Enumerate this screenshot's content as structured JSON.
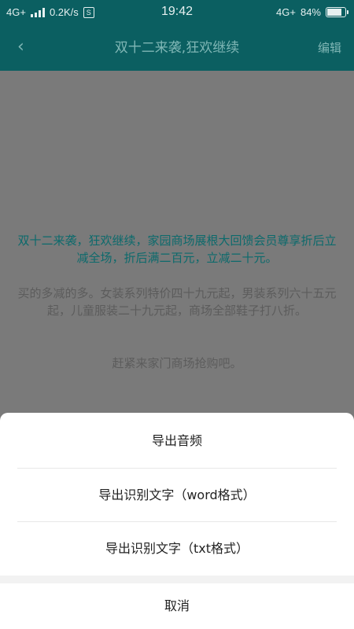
{
  "status_bar": {
    "network_left": "4G+",
    "speed": "0.2K/s",
    "s_badge": "S",
    "time": "19:42",
    "network_right": "4G+",
    "battery_text": "84%",
    "battery_level": 0.84
  },
  "header": {
    "back_icon": "chevron-left-icon",
    "title": "双十二来袭,狂欢继续",
    "edit_label": "编辑"
  },
  "content": {
    "paragraph1": "双十二来袭，狂欢继续，家园商场展根大回馈会员尊享折后立减全场，折后满二百元，立减二十元。",
    "paragraph2": "买的多减的多。女装系列特价四十九元起，男装系列六十五元起，儿童服装二十九元起，商场全部鞋子打八折。",
    "paragraph3": "赶紧来家门商场抢购吧。"
  },
  "sheet": {
    "options": [
      "导出音频",
      "导出识别文字（word格式）",
      "导出识别文字（txt格式）"
    ],
    "cancel_label": "取消"
  },
  "colors": {
    "primary": "#0b5f61",
    "overlay_bg": "#7a7a7a",
    "highlight_text": "#0c6a6c"
  }
}
